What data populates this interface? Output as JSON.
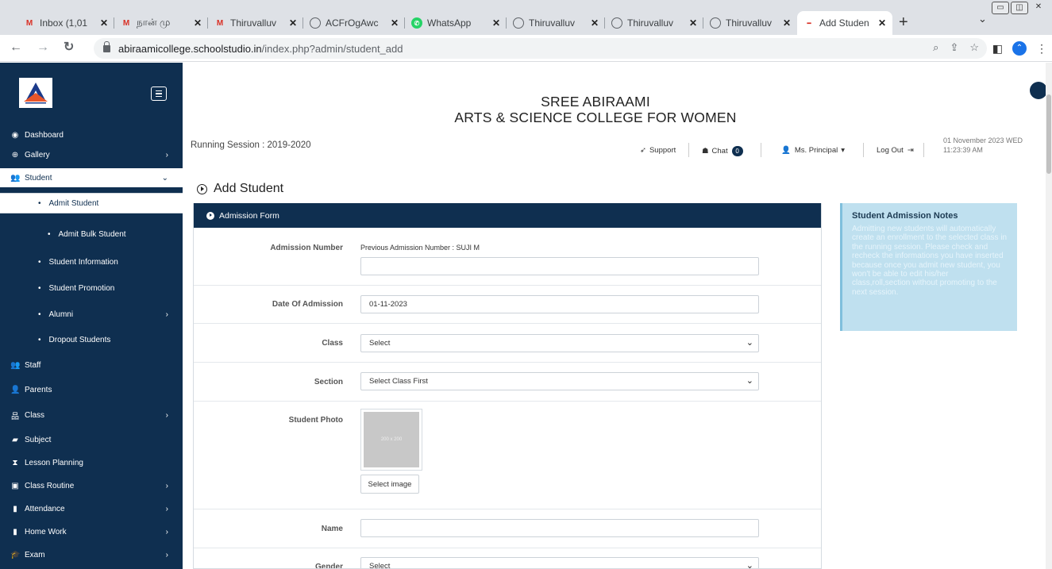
{
  "browser": {
    "tabs": [
      {
        "title": "Inbox (1,01",
        "favicon": "gmail-icon"
      },
      {
        "title": "நான் மு",
        "favicon": "gmail-icon"
      },
      {
        "title": "Thiruvalluv",
        "favicon": "gmail-icon"
      },
      {
        "title": "ACFrOgAwc",
        "favicon": "globe-icon"
      },
      {
        "title": "WhatsApp",
        "favicon": "whatsapp-icon"
      },
      {
        "title": "Thiruvalluv",
        "favicon": "globe-icon"
      },
      {
        "title": "Thiruvalluv",
        "favicon": "globe-icon"
      },
      {
        "title": "Thiruvalluv",
        "favicon": "globe-icon"
      },
      {
        "title": "Add Studen",
        "favicon": "app-icon"
      }
    ],
    "url_host": "abiraamicollege.schoolstudio.in",
    "url_path": "/index.php?admin/student_add"
  },
  "sidebar": {
    "items": [
      {
        "label": "Dashboard",
        "icon": "dashboard-icon",
        "glyph": "◉"
      },
      {
        "label": "Gallery",
        "icon": "gallery-icon",
        "glyph": "⊕",
        "arrow": "›"
      },
      {
        "label": "Student",
        "icon": "users-icon",
        "glyph": "👥",
        "arrow": "⌄"
      },
      {
        "label": "Admit Student"
      },
      {
        "label": "Admit Bulk Student"
      },
      {
        "label": "Student Information"
      },
      {
        "label": "Student Promotion"
      },
      {
        "label": "Alumni",
        "arrow": "›"
      },
      {
        "label": "Dropout Students"
      },
      {
        "label": "Staff",
        "icon": "staff-icon",
        "glyph": "👥"
      },
      {
        "label": "Parents",
        "icon": "user-icon",
        "glyph": "👤"
      },
      {
        "label": "Class",
        "icon": "sitemap-icon",
        "glyph": "品",
        "arrow": "›"
      },
      {
        "label": "Subject",
        "icon": "book-icon",
        "glyph": "▰"
      },
      {
        "label": "Lesson Planning",
        "icon": "hourglass-icon",
        "glyph": "⧗"
      },
      {
        "label": "Class Routine",
        "icon": "calendar-check-icon",
        "glyph": "▣",
        "arrow": "›"
      },
      {
        "label": "Attendance",
        "icon": "attendance-icon",
        "glyph": "▮",
        "arrow": "›"
      },
      {
        "label": "Home Work",
        "icon": "bookmark-icon",
        "glyph": "▮",
        "arrow": "›"
      },
      {
        "label": "Exam",
        "icon": "graduation-cap-icon",
        "glyph": "🎓",
        "arrow": "›"
      }
    ]
  },
  "header": {
    "college_line1": "SREE ABIRAAMI",
    "college_line2": "ARTS & SCIENCE COLLEGE FOR WOMEN",
    "session": "Running Session : 2019-2020",
    "support": "Support",
    "chat": "Chat",
    "chat_count": "0",
    "user": "Ms. Principal",
    "logout": "Log Out",
    "date": "01 November 2023 WED",
    "time": "11:23:39 AM"
  },
  "page": {
    "title": "Add Student",
    "panel_title": "Admission Form"
  },
  "form": {
    "admission_number_label": "Admission Number",
    "prev_admission": "Previous Admission Number : SUJI M",
    "admission_number_value": "",
    "date_label": "Date Of Admission",
    "date_value": "01-11-2023",
    "class_label": "Class",
    "class_value": "Select",
    "section_label": "Section",
    "section_value": "Select Class First",
    "photo_label": "Student Photo",
    "photo_placeholder": "200 x 200",
    "select_image": "Select image",
    "name_label": "Name",
    "name_value": "",
    "gender_label": "Gender",
    "gender_value": "Select"
  },
  "notes": {
    "title": "Student Admission Notes",
    "text": "Admitting new students will automatically create an enrollment to the selected class in the running session. Please check and recheck the informations you have inserted because once you admit new student, you won't be able to edit his/her class,roll,section without promoting to the next session."
  },
  "colors": {
    "primary": "#0f2f50",
    "notes_bg": "#bfe0ef"
  }
}
